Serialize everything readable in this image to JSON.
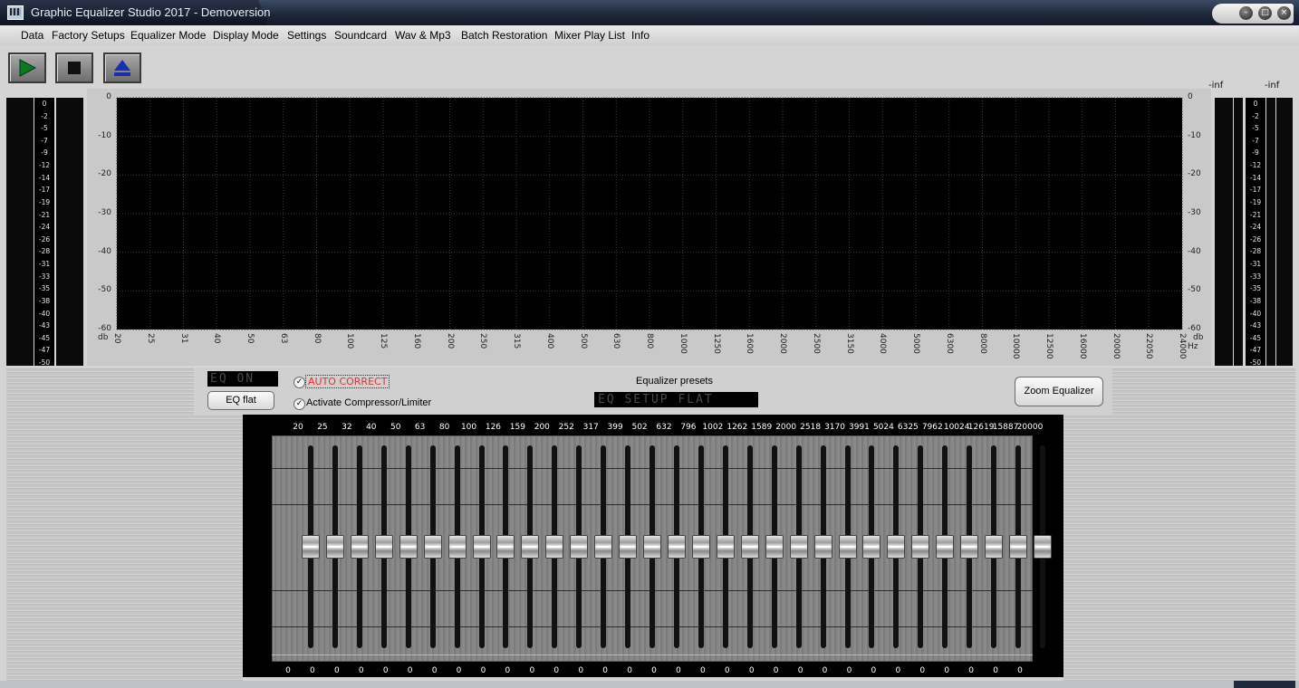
{
  "window": {
    "title": "Graphic Equalizer Studio 2017 - Demoversion",
    "buttons": {
      "minimize": "–",
      "maximize": "□",
      "close": "×"
    }
  },
  "menu": [
    "Data",
    "Factory Setups",
    "Equalizer Mode",
    "Display Mode",
    "Settings",
    "Soundcard",
    "Wav & Mp3",
    "Batch Restoration",
    "Mixer Play List",
    "Info"
  ],
  "toolbar": {
    "play_icon": "play-icon",
    "stop_icon": "stop-icon",
    "eject_icon": "eject-icon"
  },
  "analyzer": {
    "y_ticks": [
      "0",
      "-10",
      "-20",
      "-30",
      "-40",
      "-50",
      "-60"
    ],
    "y_unit": "db",
    "x_ticks": [
      "20",
      "25",
      "31",
      "40",
      "50",
      "63",
      "80",
      "100",
      "125",
      "160",
      "200",
      "250",
      "315",
      "400",
      "500",
      "630",
      "800",
      "1000",
      "1250",
      "1600",
      "2000",
      "2500",
      "3150",
      "4000",
      "5000",
      "6300",
      "8000",
      "10000",
      "12500",
      "16000",
      "20000",
      "22050",
      "24000"
    ],
    "x_unit": "Hz"
  },
  "meters": {
    "scale": [
      "0",
      "-2",
      "-5",
      "-7",
      "-9",
      "-12",
      "-14",
      "-17",
      "-19",
      "-21",
      "-24",
      "-26",
      "-28",
      "-31",
      "-33",
      "-35",
      "-38",
      "-40",
      "-43",
      "-45",
      "-47",
      "-50"
    ],
    "left_peak": "-inf",
    "right_peak": "-inf"
  },
  "controls": {
    "eq_status_lcd": "EQ ON",
    "eq_flat_label": "EQ flat",
    "auto_correct_label": "AUTO CORRECT",
    "compressor_label": "Activate Compressor/Limiter",
    "presets_label": "Equalizer presets",
    "preset_lcd": "EQ SETUP FLAT",
    "zoom_label": "Zoom Equalizer"
  },
  "equalizer": {
    "bands": [
      "20",
      "25",
      "32",
      "40",
      "50",
      "63",
      "80",
      "100",
      "126",
      "159",
      "200",
      "252",
      "317",
      "399",
      "502",
      "632",
      "796",
      "1002",
      "1262",
      "1589",
      "2000",
      "2518",
      "3170",
      "3991",
      "5024",
      "6325",
      "7962",
      "10024",
      "12619",
      "15887",
      "20000"
    ],
    "values": [
      0,
      0,
      0,
      0,
      0,
      0,
      0,
      0,
      0,
      0,
      0,
      0,
      0,
      0,
      0,
      0,
      0,
      0,
      0,
      0,
      0,
      0,
      0,
      0,
      0,
      0,
      0,
      0,
      0,
      0,
      0
    ],
    "range_db": [
      -12,
      12
    ]
  }
}
